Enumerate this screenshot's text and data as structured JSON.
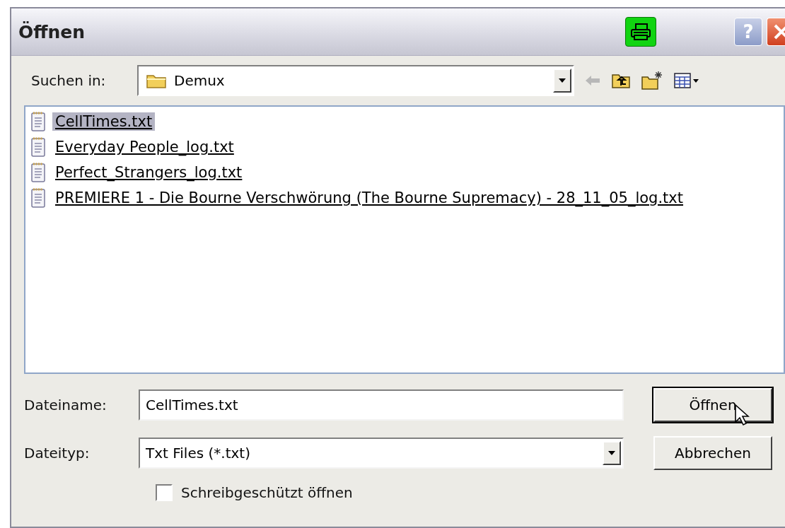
{
  "window": {
    "title": "Öffnen",
    "help_button": "?"
  },
  "look_in": {
    "label": "Suchen in:",
    "value": "Demux"
  },
  "files": [
    {
      "name": "CellTimes.txt",
      "selected": true
    },
    {
      "name": "Everyday People_log.txt",
      "selected": false
    },
    {
      "name": "Perfect_Strangers_log.txt",
      "selected": false
    },
    {
      "name": "PREMIERE 1 - Die Bourne Verschwörung (The Bourne Supremacy) - 28_11_05_log.txt",
      "selected": false
    }
  ],
  "file_name": {
    "label": "Dateiname:",
    "value": "CellTimes.txt"
  },
  "file_type": {
    "label": "Dateityp:",
    "value": "Txt Files (*.txt)"
  },
  "read_only": {
    "label": "Schreibgeschützt öffnen",
    "checked": false
  },
  "buttons": [
    {
      "label": "Öffnen",
      "kind": "default"
    },
    {
      "label": "Abbrechen",
      "kind": "normal"
    }
  ]
}
